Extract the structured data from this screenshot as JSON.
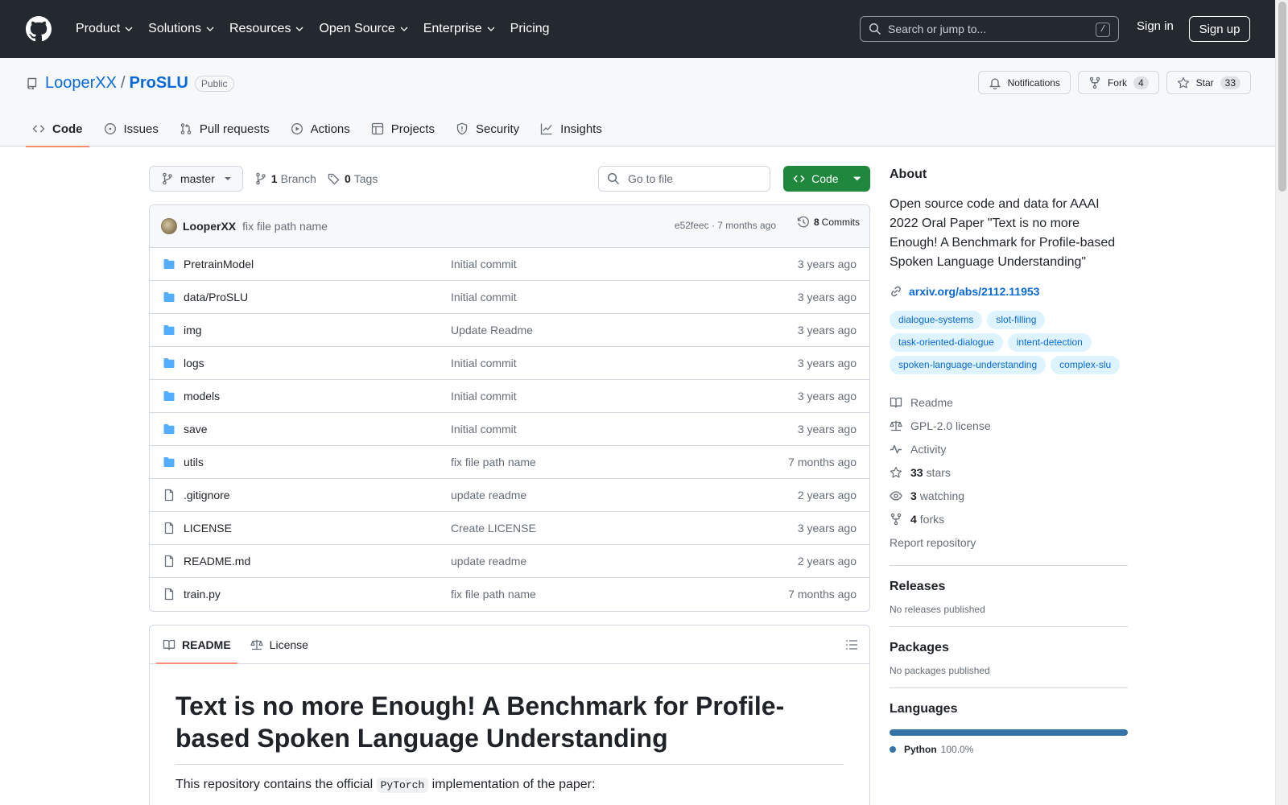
{
  "header": {
    "nav": [
      "Product",
      "Solutions",
      "Resources",
      "Open Source",
      "Enterprise",
      "Pricing"
    ],
    "search_placeholder": "Search or jump to...",
    "search_shortcut": "/",
    "signin": "Sign in",
    "signup": "Sign up"
  },
  "repo": {
    "owner": "LooperXX",
    "separator": "/",
    "name": "ProSLU",
    "visibility": "Public",
    "notifications_label": "Notifications",
    "fork_label": "Fork",
    "fork_count": "4",
    "star_label": "Star",
    "star_count": "33",
    "tabs": [
      "Code",
      "Issues",
      "Pull requests",
      "Actions",
      "Projects",
      "Security",
      "Insights"
    ]
  },
  "toolbar": {
    "branch": "master",
    "branch_count": "1",
    "branch_label": "Branch",
    "tag_count": "0",
    "tag_label": "Tags",
    "goto_placeholder": "Go to file",
    "code_label": "Code"
  },
  "commit": {
    "author": "LooperXX",
    "message": "fix file path name",
    "meta": "e52feec · 7 months ago",
    "count": "8",
    "count_label": "Commits"
  },
  "files": [
    {
      "name": "PretrainModel",
      "type": "dir",
      "message": "Initial commit",
      "date": "3 years ago"
    },
    {
      "name": "data/ProSLU",
      "type": "dir",
      "message": "Initial commit",
      "date": "3 years ago"
    },
    {
      "name": "img",
      "type": "dir",
      "message": "Update Readme",
      "date": "3 years ago"
    },
    {
      "name": "logs",
      "type": "dir",
      "message": "Initial commit",
      "date": "3 years ago"
    },
    {
      "name": "models",
      "type": "dir",
      "message": "Initial commit",
      "date": "3 years ago"
    },
    {
      "name": "save",
      "type": "dir",
      "message": "Initial commit",
      "date": "3 years ago"
    },
    {
      "name": "utils",
      "type": "dir",
      "message": "fix file path name",
      "date": "7 months ago"
    },
    {
      "name": ".gitignore",
      "type": "file",
      "message": "update readme",
      "date": "2 years ago"
    },
    {
      "name": "LICENSE",
      "type": "file",
      "message": "Create LICENSE",
      "date": "3 years ago"
    },
    {
      "name": "README.md",
      "type": "file",
      "message": "update readme",
      "date": "2 years ago"
    },
    {
      "name": "train.py",
      "type": "file",
      "message": "fix file path name",
      "date": "7 months ago"
    }
  ],
  "readme": {
    "tab_readme": "README",
    "tab_license": "License",
    "title": "Text is no more Enough! A Benchmark for Profile-based Spoken Language Understanding",
    "intro_before": "This repository contains the official ",
    "intro_code": "PyTorch",
    "intro_after": " implementation of the paper:"
  },
  "about": {
    "heading": "About",
    "description": "Open source code and data for AAAI 2022 Oral Paper \"Text is no more Enough! A Benchmark for Profile-based Spoken Language Understanding\"",
    "link": "arxiv.org/abs/2112.11953",
    "topics": [
      "dialogue-systems",
      "slot-filling",
      "task-oriented-dialogue",
      "intent-detection",
      "spoken-language-understanding",
      "complex-slu"
    ],
    "readme": "Readme",
    "license": "GPL-2.0 license",
    "activity": "Activity",
    "stars_count": "33",
    "stars_label": "stars",
    "watching_count": "3",
    "watching_label": "watching",
    "forks_count": "4",
    "forks_label": "forks",
    "report": "Report repository"
  },
  "releases": {
    "heading": "Releases",
    "text": "No releases published"
  },
  "packages": {
    "heading": "Packages",
    "text": "No packages published"
  },
  "languages": {
    "heading": "Languages",
    "name": "Python",
    "percent": "100.0%",
    "color": "#3572A5",
    "share": 1.0
  }
}
